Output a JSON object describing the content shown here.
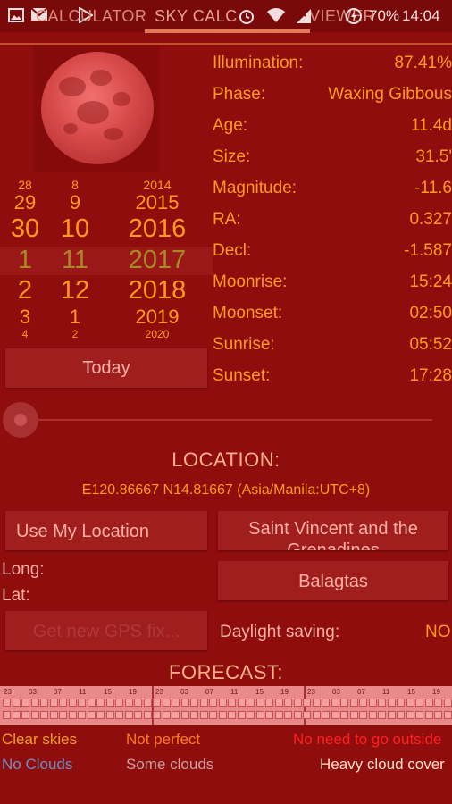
{
  "statusbar": {
    "icons": [
      "image-icon",
      "mail-icon",
      "play-store-icon",
      "alarm-icon",
      "wifi-icon",
      "signal-icon",
      "battery-saver-icon"
    ],
    "battery": "70%",
    "time": "14:04"
  },
  "tabs": [
    {
      "label": "CALCULATOR",
      "selected": false
    },
    {
      "label": "SKY CALC",
      "selected": true
    },
    {
      "label": "VIEWER",
      "selected": false
    }
  ],
  "date_picker": {
    "days": [
      "28",
      "29",
      "30",
      "1",
      "2",
      "3",
      "4"
    ],
    "months": [
      "8",
      "9",
      "10",
      "11",
      "12",
      "1",
      "2"
    ],
    "years": [
      "2014",
      "2015",
      "2016",
      "2017",
      "2018",
      "2019",
      "2020"
    ]
  },
  "today_button": "Today",
  "moon_info": [
    {
      "label": "Illumination:",
      "value": "87.41%"
    },
    {
      "label": "Phase:",
      "value": "Waxing Gibbous"
    },
    {
      "label": "Age:",
      "value": "11.4d"
    },
    {
      "label": "Size:",
      "value": "31.5'"
    },
    {
      "label": "Magnitude:",
      "value": "-11.6"
    },
    {
      "label": "RA:",
      "value": "0.327"
    },
    {
      "label": "Decl:",
      "value": "-1.587"
    },
    {
      "label": "Moonrise:",
      "value": "15:24"
    },
    {
      "label": "Moonset:",
      "value": "02:50"
    },
    {
      "label": "Sunrise:",
      "value": "05:52"
    },
    {
      "label": "Sunset:",
      "value": "17:28"
    }
  ],
  "location": {
    "title": "LOCATION:",
    "coords": "E120.86667 N14.81667 (Asia/Manila:UTC+8)",
    "use_my_location": "Use My Location",
    "country": "Saint Vincent and the",
    "country_cutoff": "Grenadines",
    "city": "Balagtas",
    "long_label": "Long:",
    "lat_label": "Lat:",
    "gps_button": "Get new GPS fix...",
    "daylight_label": "Daylight saving:",
    "daylight_value": "NO"
  },
  "forecast": {
    "title": "FORECAST:",
    "hours": [
      "23",
      "03",
      "07",
      "11",
      "15",
      "19",
      "23",
      "03",
      "07",
      "11",
      "15",
      "19",
      "23",
      "03",
      "07",
      "11",
      "15",
      "19"
    ],
    "legend_row1": [
      "Clear skies",
      "Not perfect",
      "No need to go outside"
    ],
    "legend_row2": [
      "No Clouds",
      "Some clouds",
      "Heavy cloud cover"
    ]
  },
  "colors": {
    "background": "#8f0d0d",
    "accent": "#ff9a1e",
    "clear_skies": "#f0a020",
    "not_perfect": "#ff7a20",
    "no_need": "#ff2020",
    "no_clouds": "#7090c0",
    "some_clouds": "#c8a0a0",
    "heavy_clouds": "#ffe0c8"
  }
}
